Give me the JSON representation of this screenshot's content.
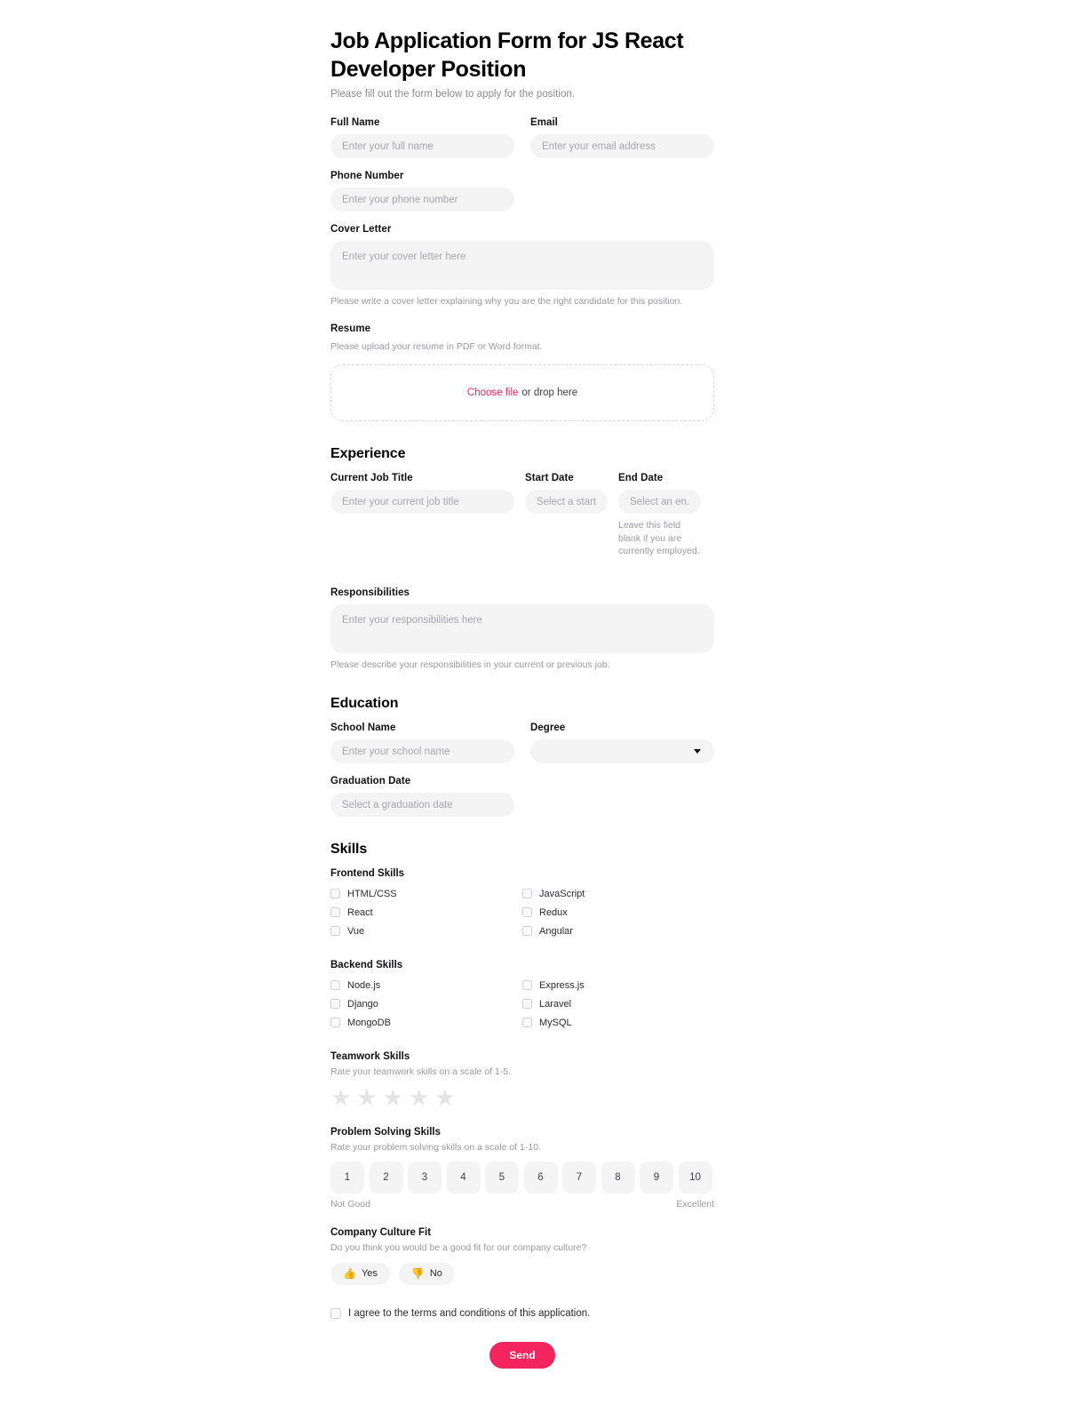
{
  "header": {
    "title": "Job Application Form for JS React Developer Position",
    "subtitle": "Please fill out the form below to apply for the position."
  },
  "personal": {
    "full_name_label": "Full Name",
    "full_name_placeholder": "Enter your full name",
    "email_label": "Email",
    "email_placeholder": "Enter your email address",
    "phone_label": "Phone Number",
    "phone_placeholder": "Enter your phone number",
    "cover_letter_label": "Cover Letter",
    "cover_letter_placeholder": "Enter your cover letter here",
    "cover_letter_helper": "Please write a cover letter explaining why you are the right candidate for this position."
  },
  "resume": {
    "label": "Resume",
    "helper": "Please upload your resume in PDF or Word format.",
    "choose_link": "Choose file",
    "drop_text": "or drop here"
  },
  "experience": {
    "heading": "Experience",
    "job_title_label": "Current Job Title",
    "job_title_placeholder": "Enter your current job title",
    "start_date_label": "Start Date",
    "start_date_placeholder": "Select a start...",
    "end_date_label": "End Date",
    "end_date_placeholder": "Select an en...",
    "end_date_helper": "Leave this field blank if you are currently employed.",
    "responsibilities_label": "Responsibilities",
    "responsibilities_placeholder": "Enter your responsibilities here",
    "responsibilities_helper": "Please describe your responsibilities in your current or previous job."
  },
  "education": {
    "heading": "Education",
    "school_label": "School Name",
    "school_placeholder": "Enter your school name",
    "degree_label": "Degree",
    "degree_value": "",
    "graduation_label": "Graduation Date",
    "graduation_placeholder": "Select a graduation date"
  },
  "skills": {
    "heading": "Skills",
    "frontend_label": "Frontend Skills",
    "frontend_left": [
      "HTML/CSS",
      "React",
      "Vue"
    ],
    "frontend_right": [
      "JavaScript",
      "Redux",
      "Angular"
    ],
    "backend_label": "Backend Skills",
    "backend_left": [
      "Node.js",
      "Django",
      "MongoDB"
    ],
    "backend_right": [
      "Express.js",
      "Laravel",
      "MySQL"
    ],
    "teamwork_label": "Teamwork Skills",
    "teamwork_helper": "Rate your teamwork skills on a scale of 1-5.",
    "star_count": 5,
    "star_glyph": "★",
    "problem_label": "Problem Solving Skills",
    "problem_helper": "Rate your problem solving skills on a scale of 1-10.",
    "scale_values": [
      "1",
      "2",
      "3",
      "4",
      "5",
      "6",
      "7",
      "8",
      "9",
      "10"
    ],
    "scale_low_label": "Not Good",
    "scale_high_label": "Excellent"
  },
  "culture": {
    "label": "Company Culture Fit",
    "helper": "Do you think you would be a good fit for our company culture?",
    "yes_label": "Yes",
    "no_label": "No",
    "yes_icon": "👍",
    "no_icon": "👎"
  },
  "terms": {
    "label": "I agree to the terms and conditions of this application."
  },
  "submit": {
    "label": "Send"
  },
  "colors": {
    "accent": "#f4245e",
    "input_bg": "#f4f4f5",
    "text": "#18181b",
    "muted": "#9a9aa0"
  }
}
